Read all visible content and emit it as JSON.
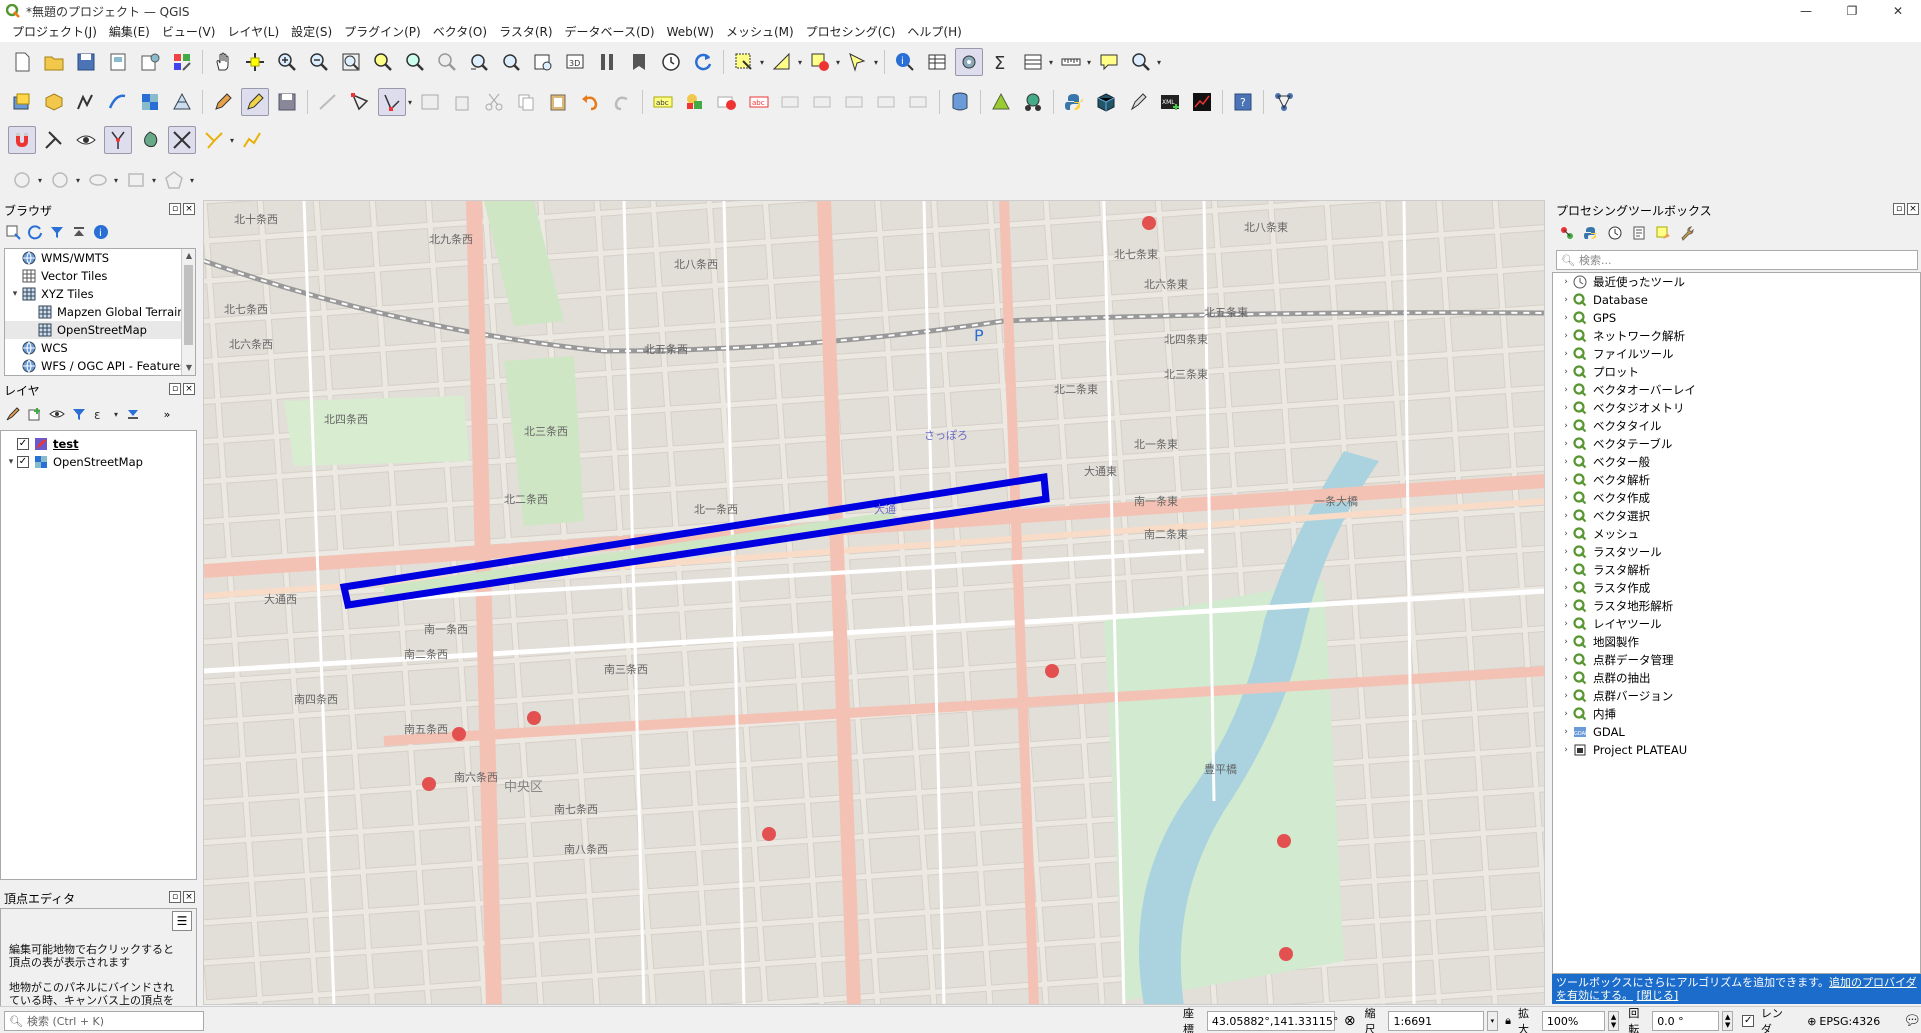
{
  "window": {
    "title": "*無題のプロジェクト — QGIS",
    "minimize": "—",
    "maximize": "❐",
    "close": "✕"
  },
  "menu": [
    "プロジェクト(J)",
    "編集(E)",
    "ビュー(V)",
    "レイヤ(L)",
    "設定(S)",
    "プラグイン(P)",
    "ベクタ(O)",
    "ラスタ(R)",
    "データベース(D)",
    "Web(W)",
    "メッシュ(M)",
    "プロセシング(C)",
    "ヘルプ(H)"
  ],
  "browser": {
    "title": "ブラウザ",
    "items": [
      {
        "label": "WMS/WMTS",
        "indent": 0,
        "arrow": "",
        "icon": "globe-icon"
      },
      {
        "label": "Vector Tiles",
        "indent": 0,
        "arrow": "",
        "icon": "grid-icon"
      },
      {
        "label": "XYZ Tiles",
        "indent": 0,
        "arrow": "▾",
        "icon": "grid-icon"
      },
      {
        "label": "Mapzen Global Terrain",
        "indent": 1,
        "arrow": "",
        "icon": "grid-icon"
      },
      {
        "label": "OpenStreetMap",
        "indent": 1,
        "arrow": "",
        "icon": "grid-icon"
      },
      {
        "label": "WCS",
        "indent": 0,
        "arrow": "",
        "icon": "globe-icon"
      },
      {
        "label": "WFS / OGC API - Features",
        "indent": 0,
        "arrow": "",
        "icon": "globe-icon"
      }
    ]
  },
  "layers": {
    "title": "レイヤ",
    "items": [
      {
        "label": "test",
        "checked": "✓"
      },
      {
        "label": "OpenStreetMap",
        "checked": "✓"
      }
    ]
  },
  "vertex_editor": {
    "title": "頂点エディタ",
    "text1": "編集可能地物で右クリックすると頂点の表が表示されます",
    "text2": "地物がこのパネルにバインドされている時、キャンバス上の頂点を選"
  },
  "processing": {
    "title": "プロセシングツールボックス",
    "search_placeholder": "検索...",
    "items": [
      "最近使ったツール",
      "Database",
      "GPS",
      "ネットワーク解析",
      "ファイルツール",
      "プロット",
      "ベクタオーバーレイ",
      "ベクタジオメトリ",
      "ベクタタイル",
      "ベクタテーブル",
      "ベクター般",
      "ベクタ解析",
      "ベクタ作成",
      "ベクタ選択",
      "メッシュ",
      "ラスタツール",
      "ラスタ解析",
      "ラスタ作成",
      "ラスタ地形解析",
      "レイヤツール",
      "地図製作",
      "点群データ管理",
      "点群の抽出",
      "点群バージョン",
      "内挿",
      "GDAL",
      "Project PLATEAU"
    ],
    "banner_text": "ツールボックスにさらにアルゴリズムを追加できます。",
    "banner_link": "追加のプロバイダを有効にする。",
    "banner_close": "[閉じる]"
  },
  "statusbar": {
    "locator_placeholder": "検索 (Ctrl + K)",
    "coord_label": "座標",
    "coord_value": "43.05882°,141.33115°",
    "scale_label": "縮尺",
    "scale_value": "1:6691",
    "zoom_label": "拡大",
    "zoom_value": "100%",
    "rotation_label": "回転",
    "rotation_value": "0.0 °",
    "render_label": "レンダ",
    "crs": "EPSG:4326"
  },
  "map": {
    "labels": [
      "北十条西",
      "北九条西",
      "北八条西",
      "北七条西",
      "北六条西",
      "北五条西",
      "北四条西",
      "北三条西",
      "北二条西",
      "北一条西",
      "大通西",
      "南一条西",
      "南二条西",
      "南三条西",
      "南四条西",
      "南五条西",
      "南六条西",
      "南七条西",
      "南八条西",
      "北八条東",
      "北七条東",
      "北六条東",
      "北五条東",
      "北四条東",
      "北三条東",
      "北二条東",
      "北一条東",
      "大通東",
      "南一条東",
      "南二条東",
      "中央区",
      "さっぽろ",
      "大通",
      "豊平橋",
      "一条大橋"
    ],
    "accent_line": "#0000e0"
  }
}
